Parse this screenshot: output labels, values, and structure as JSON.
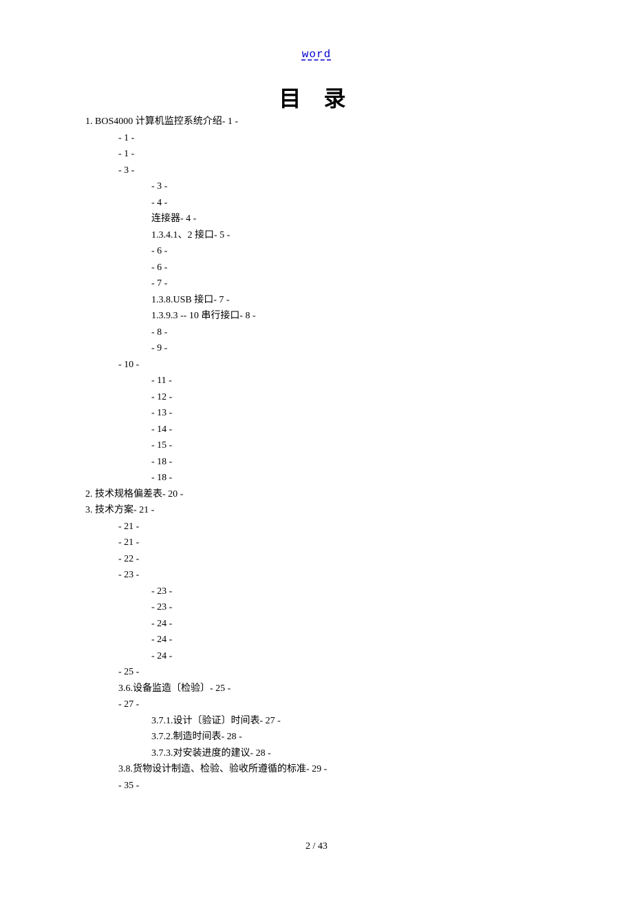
{
  "header_link": "word",
  "title": "目 录",
  "footer": "2  / 43",
  "toc": [
    {
      "lvl": 0,
      "text": "1. BOS4000 计算机监控系统介绍- 1 -"
    },
    {
      "lvl": 1,
      "text": "- 1 -"
    },
    {
      "lvl": 1,
      "text": "- 1 -"
    },
    {
      "lvl": 1,
      "text": "- 3 -"
    },
    {
      "lvl": 2,
      "text": "- 3 -"
    },
    {
      "lvl": 2,
      "text": "- 4 -"
    },
    {
      "lvl": 2,
      "text": "连接器- 4 -"
    },
    {
      "lvl": 2,
      "text": "1.3.4.1、2 接口- 5 -"
    },
    {
      "lvl": 2,
      "text": "- 6 -"
    },
    {
      "lvl": 2,
      "text": "- 6 -"
    },
    {
      "lvl": 2,
      "text": "- 7 -"
    },
    {
      "lvl": 2,
      "text": "1.3.8.USB 接口- 7 -"
    },
    {
      "lvl": 2,
      "text": "1.3.9.3 -- 10 串行接口- 8 -"
    },
    {
      "lvl": 2,
      "text": "- 8 -"
    },
    {
      "lvl": 2,
      "text": "- 9 -"
    },
    {
      "lvl": 1,
      "text": "- 10 -"
    },
    {
      "lvl": 2,
      "text": "- 11 -"
    },
    {
      "lvl": 2,
      "text": "- 12 -"
    },
    {
      "lvl": 2,
      "text": "- 13 -"
    },
    {
      "lvl": 2,
      "text": "- 14 -"
    },
    {
      "lvl": 2,
      "text": "- 15 -"
    },
    {
      "lvl": 2,
      "text": "- 18 -"
    },
    {
      "lvl": 2,
      "text": "- 18 -"
    },
    {
      "lvl": 0,
      "text": "2. 技术规格偏差表- 20 -"
    },
    {
      "lvl": 0,
      "text": "3. 技术方案- 21 -"
    },
    {
      "lvl": 1,
      "text": "- 21 -"
    },
    {
      "lvl": 1,
      "text": "- 21 -"
    },
    {
      "lvl": 1,
      "text": "- 22 -"
    },
    {
      "lvl": 1,
      "text": "- 23 -"
    },
    {
      "lvl": 2,
      "text": "- 23 -"
    },
    {
      "lvl": 2,
      "text": "- 23 -"
    },
    {
      "lvl": 2,
      "text": "- 24 -"
    },
    {
      "lvl": 2,
      "text": "- 24 -"
    },
    {
      "lvl": 2,
      "text": "- 24 -"
    },
    {
      "lvl": 1,
      "text": "- 25 -"
    },
    {
      "lvl": 1,
      "text": "3.6.设备监造〔检验〕- 25 -"
    },
    {
      "lvl": 1,
      "text": "- 27 -"
    },
    {
      "lvl": 2,
      "text": "3.7.1.设计〔验证〕时间表- 27 -"
    },
    {
      "lvl": 2,
      "text": "3.7.2.制造时间表- 28 -"
    },
    {
      "lvl": 2,
      "text": "3.7.3.对安装进度的建议- 28 -"
    },
    {
      "lvl": 1,
      "text": "3.8.货物设计制造、检验、验收所遵循的标准- 29 -"
    },
    {
      "lvl": 1,
      "text": "- 35 -"
    }
  ]
}
